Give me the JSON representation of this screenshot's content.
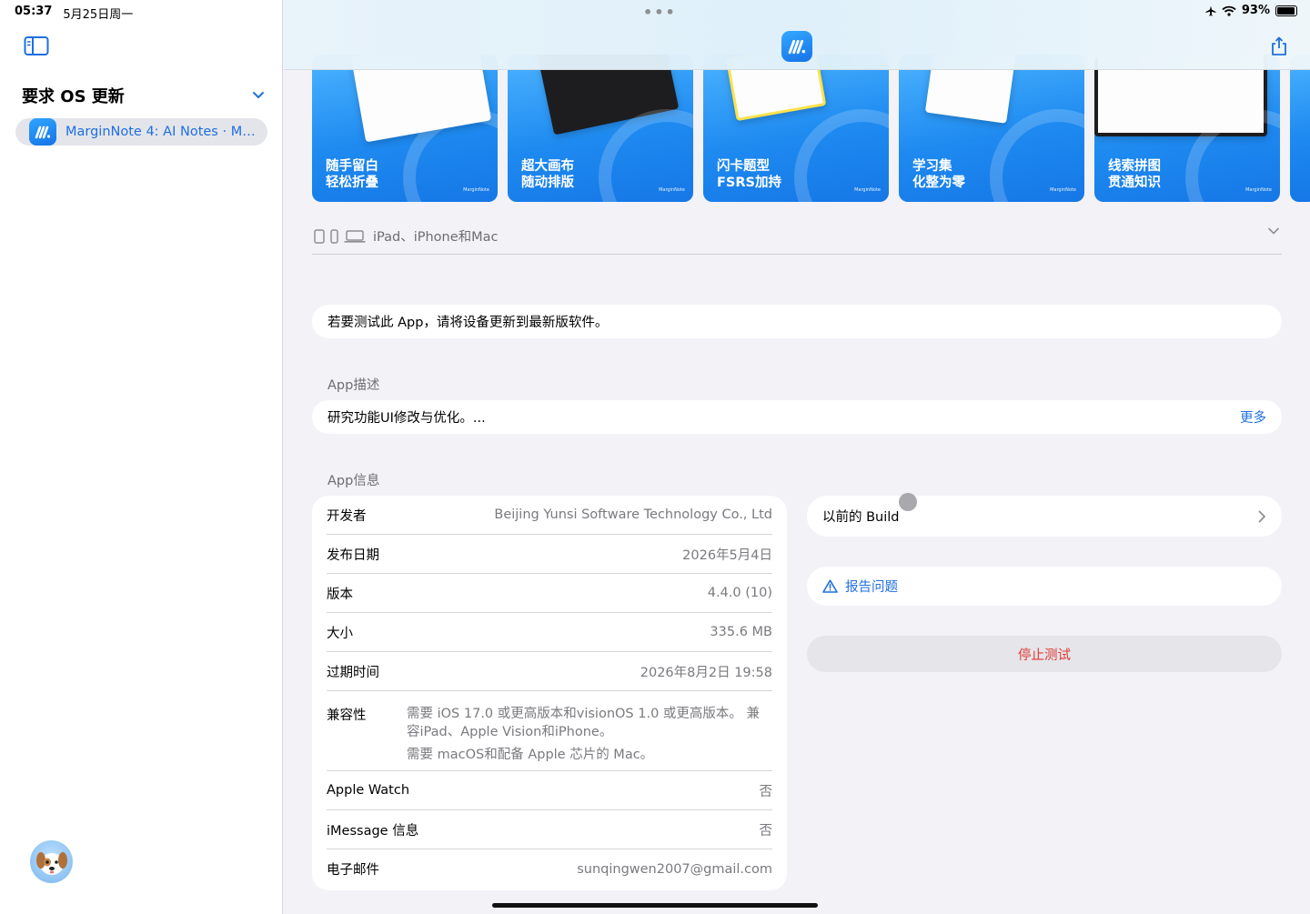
{
  "status": {
    "time": "05:37",
    "date": "5月25日周一",
    "battery": "93%",
    "battery_level": 0.93
  },
  "sidebar": {
    "section_title": "要求 OS 更新",
    "items": [
      {
        "label": "MarginNote 4: AI Notes · Mi..."
      }
    ]
  },
  "screenshots": [
    {
      "line1": "随手留白",
      "line2": "轻松折叠",
      "brand": "MarginNote"
    },
    {
      "line1": "超大画布",
      "line2": "随动排版",
      "brand": "MarginNote"
    },
    {
      "line1": "闪卡题型",
      "line2": "FSRS加持",
      "brand": "MarginNote"
    },
    {
      "line1": "学习集",
      "line2": "化整为零",
      "brand": "MarginNote"
    },
    {
      "line1": "线索拼图",
      "line2": "贯通知识",
      "brand": "MarginNote"
    }
  ],
  "devices": {
    "label": "iPad、iPhone和Mac"
  },
  "notice": "若要测试此 App，请将设备更新到最新版软件。",
  "description": {
    "section_label": "App描述",
    "text": "研究功能UI修改与优化。...",
    "more": "更多"
  },
  "info": {
    "section_label": "App信息",
    "developer": {
      "k": "开发者",
      "v": "Beijing Yunsi Software Technology Co., Ltd"
    },
    "release_date": {
      "k": "发布日期",
      "v": "2026年5月4日"
    },
    "version": {
      "k": "版本",
      "v": "4.4.0 (10)"
    },
    "size": {
      "k": "大小",
      "v": "335.6 MB"
    },
    "expires": {
      "k": "过期时间",
      "v": "2026年8月2日 19:58"
    },
    "compatibility": {
      "k": "兼容性",
      "line1": "需要 iOS 17.0 或更高版本和visionOS 1.0 或更高版本。 兼容iPad、Apple Vision和iPhone。",
      "line2": "需要 macOS和配备 Apple 芯片的 Mac。"
    },
    "apple_watch": {
      "k": "Apple Watch",
      "v": "否"
    },
    "imessage": {
      "k": "iMessage 信息",
      "v": "否"
    },
    "email": {
      "k": "电子邮件",
      "v": "sunqingwen2007@gmail.com"
    }
  },
  "actions": {
    "previous_builds": "以前的 Build",
    "report": "报告问题",
    "stop": "停止测试"
  },
  "colors": {
    "accent": "#1f6fe0",
    "destructive": "#e0392f",
    "background": "#f2f2f7"
  }
}
